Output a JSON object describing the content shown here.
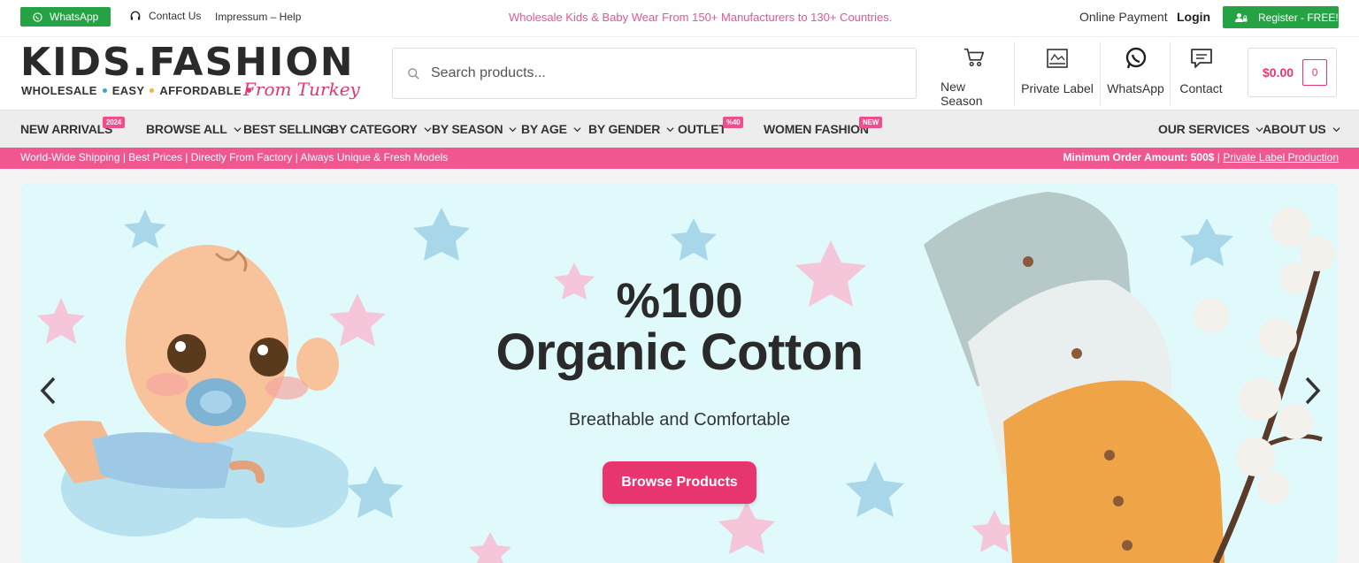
{
  "topbar": {
    "whatsapp_label": "WhatsApp",
    "contact_label": "Contact Us",
    "impressum_label": "Impressum – Help",
    "promo_text": "Wholesale Kids & Baby Wear From 150+ Manufacturers to 130+ Countries.",
    "online_payment_label": "Online Payment",
    "login_label": "Login",
    "register_label": "Register - FREE!"
  },
  "header": {
    "logo_title": "KIDS.FASHION",
    "logo_tagline_1": "WHOLESALE",
    "logo_tagline_2": "EASY",
    "logo_tagline_3": "AFFORDABLE",
    "logo_script": "From Turkey",
    "search_placeholder": "Search products...",
    "icons": [
      {
        "label": "New Season",
        "icon": "cart-icon"
      },
      {
        "label": "Private Label",
        "icon": "label-icon"
      },
      {
        "label": "WhatsApp",
        "icon": "whatsapp-icon"
      },
      {
        "label": "Contact",
        "icon": "chat-icon"
      }
    ],
    "cart_amount": "$0.00",
    "cart_count": "0"
  },
  "nav": {
    "items": [
      {
        "label": "NEW ARRIVALS",
        "badge": "2024"
      },
      {
        "label": "BROWSE ALL"
      },
      {
        "label": "BEST SELLING"
      },
      {
        "label": "BY CATEGORY"
      },
      {
        "label": "BY SEASON"
      },
      {
        "label": "BY AGE"
      },
      {
        "label": "BY GENDER"
      },
      {
        "label": "OUTLET",
        "badge": "%40"
      },
      {
        "label": "WOMEN FASHION",
        "badge": "NEW"
      },
      {
        "label": "OUR SERVICES"
      },
      {
        "label": "ABOUT US"
      }
    ]
  },
  "strip": {
    "left_text": "World-Wide Shipping | Best Prices | Directly From Factory | Always Unique & Fresh Models",
    "min_order": "Minimum Order Amount: 500$",
    "separator": "|",
    "private_label_link": "Private Label Production"
  },
  "hero": {
    "title_line_1": "%100",
    "title_line_2": "Organic Cotton",
    "subtitle": "Breathable and Comfortable",
    "button_label": "Browse Products"
  },
  "colors": {
    "brand_pink": "#e8356f",
    "strip_pink": "#f0578f",
    "green": "#25a244",
    "hero_bg": "#e0fafb"
  }
}
